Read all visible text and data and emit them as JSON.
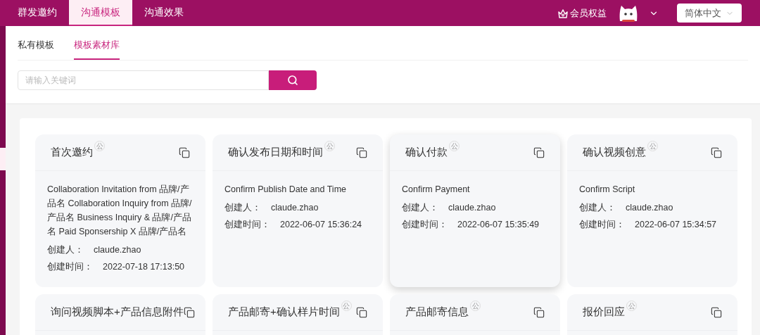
{
  "top_nav": [
    {
      "label": "群发邀约",
      "selected": false
    },
    {
      "label": "沟通模板",
      "selected": true
    },
    {
      "label": "沟通效果",
      "selected": false
    }
  ],
  "membership": {
    "label": "会员权益"
  },
  "language_select": {
    "value": "简体中文"
  },
  "sub_tabs": [
    {
      "label": "私有模板",
      "selected": false
    },
    {
      "label": "模板素材库",
      "selected": true
    }
  ],
  "search": {
    "placeholder": "请输入关键词"
  },
  "cards": [
    {
      "title": "首次邀约",
      "badge": "公",
      "hovered": false,
      "description": "Collaboration Invitation from 品牌/产品名 Collaboration Inquiry from 品牌/产品名 Business Inquiry & 品牌/产品名 Paid Sponsership X 品牌/产品名",
      "creator_label": "创建人：",
      "creator": "claude.zhao",
      "time_label": "创建时间：",
      "time": "2022-07-18 17:13:50"
    },
    {
      "title": "确认发布日期和时间",
      "badge": "公",
      "hovered": false,
      "description": "Confirm Publish Date and Time",
      "creator_label": "创建人：",
      "creator": "claude.zhao",
      "time_label": "创建时间：",
      "time": "2022-06-07 15:36:24"
    },
    {
      "title": "确认付款",
      "badge": "公",
      "hovered": true,
      "description": "Confirm Payment",
      "creator_label": "创建人：",
      "creator": "claude.zhao",
      "time_label": "创建时间：",
      "time": "2022-06-07 15:35:49"
    },
    {
      "title": "确认视频创意",
      "badge": "公",
      "hovered": false,
      "description": "Confirm Script",
      "creator_label": "创建人：",
      "creator": "claude.zhao",
      "time_label": "创建时间：",
      "time": "2022-06-07 15:34:57"
    },
    {
      "title": "询问视频脚本+产品信息附件",
      "hovered": false
    },
    {
      "title": "产品邮寄+确认样片时间",
      "badge": "公",
      "hovered": false
    },
    {
      "title": "产品邮寄信息",
      "badge": "公",
      "hovered": false
    },
    {
      "title": "报价回应",
      "badge": "公",
      "hovered": false
    }
  ]
}
